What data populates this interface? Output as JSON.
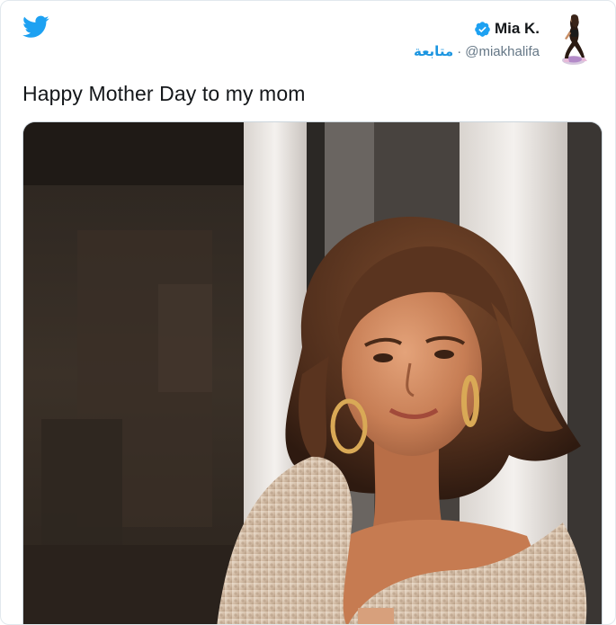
{
  "tweet": {
    "display_name": "Mia K.",
    "handle": "@miakhalifa",
    "separator": "·",
    "follow_label": "متابعة",
    "text": "Happy Mother Day to my mom",
    "verified": true
  },
  "icons": {
    "logo": "twitter-bird-icon",
    "verified": "verified-badge-icon"
  },
  "colors": {
    "twitter_blue": "#1da1f2",
    "follow_blue": "#1b95e0",
    "text": "#14171a",
    "muted": "#657786",
    "border": "#e1e8ed"
  }
}
